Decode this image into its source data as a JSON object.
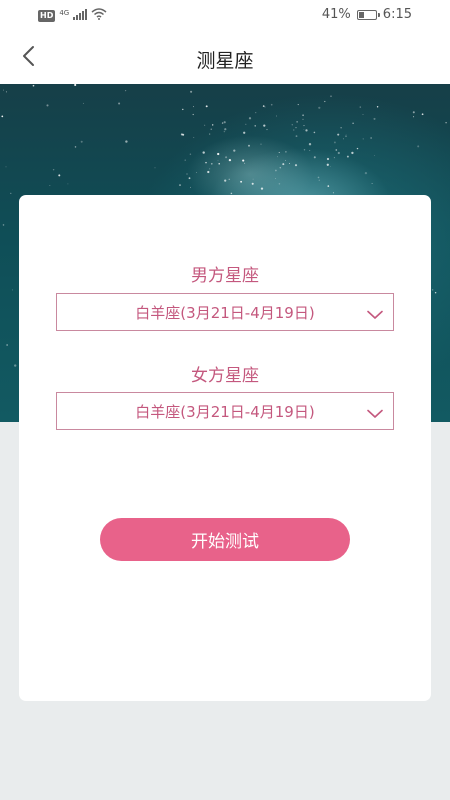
{
  "status_bar": {
    "hd_badge": "HD",
    "network": "4G",
    "battery_percent": "41%",
    "battery_level": 0.41,
    "time": "6:15"
  },
  "nav": {
    "title": "测星座"
  },
  "form": {
    "male_label": "男方星座",
    "male_value": "白羊座(3月21日-4月19日)",
    "female_label": "女方星座",
    "female_value": "白羊座(3月21日-4月19日)",
    "start_button": "开始测试"
  },
  "colors": {
    "accent": "#c4587e",
    "button": "#e8628a",
    "page_background": "#e9eced"
  },
  "icons": {
    "back": "chevron-left-icon",
    "dropdown": "chevron-down-icon",
    "signal": "signal-icon",
    "wifi": "wifi-icon",
    "battery": "battery-icon"
  }
}
